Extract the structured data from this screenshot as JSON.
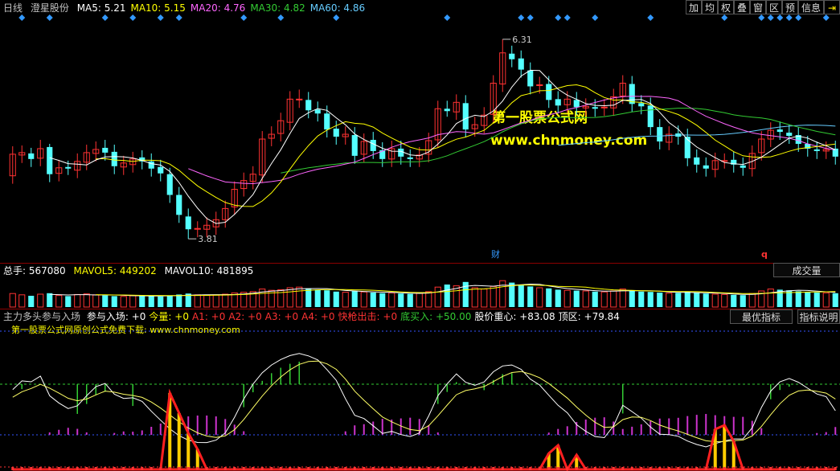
{
  "header": {
    "period": "日线",
    "stock": "澄星股份",
    "ma": [
      {
        "label": "MA5: 5.21",
        "color": "#ffffff"
      },
      {
        "label": "MA10: 5.15",
        "color": "#ffff00"
      },
      {
        "label": "MA20: 4.76",
        "color": "#ff66ff"
      },
      {
        "label": "MA30: 4.82",
        "color": "#33cc33"
      },
      {
        "label": "MA60: 4.86",
        "color": "#66ccff"
      }
    ]
  },
  "toolbar": [
    "加",
    "均",
    "权",
    "叠",
    "窗",
    "区",
    "预",
    "信息",
    "⇥"
  ],
  "annotations": {
    "high": "6.31",
    "low": "3.81",
    "cai": "财",
    "q": "q"
  },
  "volume": {
    "total_label": "总手: 567080",
    "mavol5_label": "MAVOL5: 449202",
    "mavol10_label": "MAVOL10: 481895",
    "button": "成交量"
  },
  "indicator": {
    "title": "主力多头参与入场",
    "items": [
      {
        "label": "参与入场: +0",
        "color": "#ffffff"
      },
      {
        "label": "今量: +0",
        "color": "#ffff00"
      },
      {
        "label": "A1: +0",
        "color": "#ff3333"
      },
      {
        "label": "A2: +0",
        "color": "#ff3333"
      },
      {
        "label": "A3: +0",
        "color": "#ff3333"
      },
      {
        "label": "A4: +0",
        "color": "#ff3333"
      },
      {
        "label": "快枪出击: +0",
        "color": "#ff3333"
      },
      {
        "label": "底买入: +50.00",
        "color": "#33cc33"
      },
      {
        "label": "股价重心: +83.08",
        "color": "#ffffff"
      },
      {
        "label": "顶区: +79.84",
        "color": "#ffffff"
      }
    ],
    "btn1": "最优指标",
    "btn2": "指标说明",
    "notice": "第一股票公式网原创公式免费下载: www.chnmoney.com"
  },
  "watermark": {
    "line1": "第一股票公式网",
    "line2": "www.chnmoney.com"
  },
  "colors": {
    "up": "#ff3232",
    "down": "#54ffff"
  },
  "chart_data": {
    "type": "candlestick",
    "count": 90,
    "open": [
      4.6,
      4.86,
      4.88,
      4.82,
      4.96,
      4.63,
      4.71,
      4.67,
      4.77,
      4.88,
      4.95,
      4.9,
      4.71,
      4.74,
      4.83,
      4.78,
      4.71,
      4.62,
      4.36,
      4.09,
      3.93,
      3.93,
      3.96,
      4.05,
      4.21,
      4.44,
      4.53,
      4.61,
      5.07,
      5.13,
      5.27,
      5.55,
      5.55,
      5.43,
      5.38,
      5.19,
      5.09,
      5.11,
      4.87,
      5.05,
      4.92,
      4.81,
      4.94,
      4.83,
      4.81,
      4.87,
      5.05,
      5.44,
      5.4,
      5.51,
      5.19,
      5.23,
      5.37,
      5.75,
      6.13,
      6.07,
      5.92,
      5.73,
      5.75,
      5.56,
      5.49,
      5.55,
      5.45,
      5.46,
      5.45,
      5.45,
      5.6,
      5.75,
      5.51,
      5.48,
      5.21,
      5.02,
      5.13,
      5.09,
      4.83,
      4.73,
      4.68,
      4.78,
      4.8,
      4.73,
      4.69,
      4.89,
      5.06,
      5.18,
      5.14,
      5.11,
      5.0,
      4.93,
      4.91,
      4.94
    ],
    "close": [
      4.87,
      4.89,
      4.81,
      4.94,
      4.62,
      4.7,
      4.69,
      4.78,
      4.89,
      4.93,
      4.89,
      4.72,
      4.76,
      4.81,
      4.78,
      4.69,
      4.63,
      4.36,
      4.11,
      3.93,
      3.94,
      3.98,
      4.05,
      4.19,
      4.43,
      4.54,
      4.62,
      5.06,
      5.12,
      5.29,
      5.56,
      5.56,
      5.42,
      5.38,
      5.18,
      5.09,
      5.12,
      4.85,
      5.03,
      4.91,
      4.81,
      4.94,
      4.84,
      4.81,
      4.86,
      5.04,
      5.44,
      5.41,
      5.52,
      5.18,
      5.24,
      5.36,
      5.76,
      6.14,
      6.06,
      5.93,
      5.72,
      5.74,
      5.55,
      5.48,
      5.56,
      5.46,
      5.47,
      5.44,
      5.46,
      5.59,
      5.76,
      5.5,
      5.47,
      5.21,
      5.03,
      5.12,
      5.09,
      4.82,
      4.74,
      4.69,
      4.79,
      4.79,
      4.74,
      4.7,
      4.88,
      5.06,
      5.17,
      5.15,
      5.1,
      5.0,
      4.94,
      4.91,
      4.93,
      4.84
    ],
    "high": [
      4.97,
      4.98,
      4.95,
      5.05,
      5.0,
      4.8,
      4.79,
      4.88,
      4.99,
      5.03,
      5.05,
      4.99,
      4.85,
      4.9,
      4.92,
      4.88,
      4.8,
      4.7,
      4.46,
      4.19,
      4.03,
      4.08,
      4.15,
      4.29,
      4.53,
      4.64,
      4.72,
      5.16,
      5.22,
      5.39,
      5.66,
      5.68,
      5.65,
      5.53,
      5.48,
      5.29,
      5.22,
      5.21,
      5.13,
      5.15,
      5.02,
      5.04,
      5.04,
      4.93,
      4.96,
      5.14,
      5.54,
      5.54,
      5.62,
      5.61,
      5.34,
      5.46,
      5.86,
      6.31,
      6.23,
      6.17,
      6.02,
      5.84,
      5.85,
      5.66,
      5.66,
      5.65,
      5.57,
      5.56,
      5.56,
      5.69,
      5.86,
      5.85,
      5.61,
      5.58,
      5.31,
      5.22,
      5.23,
      5.19,
      4.93,
      4.83,
      4.89,
      4.88,
      4.9,
      4.83,
      4.98,
      5.16,
      5.27,
      5.28,
      5.24,
      5.21,
      5.1,
      5.03,
      5.03,
      5.04
    ],
    "low": [
      4.5,
      4.76,
      4.71,
      4.72,
      4.52,
      4.53,
      4.61,
      4.57,
      4.67,
      4.78,
      4.79,
      4.62,
      4.61,
      4.64,
      4.68,
      4.59,
      4.53,
      4.26,
      4.01,
      3.81,
      3.83,
      3.83,
      3.86,
      3.95,
      4.11,
      4.34,
      4.43,
      4.51,
      4.97,
      5.03,
      5.17,
      5.45,
      5.32,
      5.28,
      5.08,
      4.99,
      4.99,
      4.75,
      4.77,
      4.81,
      4.71,
      4.71,
      4.74,
      4.71,
      4.71,
      4.77,
      4.95,
      5.34,
      5.3,
      5.08,
      5.09,
      5.13,
      5.27,
      5.65,
      5.96,
      5.83,
      5.62,
      5.63,
      5.45,
      5.38,
      5.39,
      5.36,
      5.35,
      5.34,
      5.35,
      5.35,
      5.5,
      5.4,
      5.37,
      5.11,
      4.93,
      4.92,
      4.99,
      4.72,
      4.64,
      4.59,
      4.58,
      4.69,
      4.64,
      4.6,
      4.59,
      4.79,
      4.96,
      5.05,
      5.0,
      4.9,
      4.84,
      4.81,
      4.81,
      4.74
    ],
    "volume": [
      420,
      380,
      350,
      400,
      430,
      360,
      340,
      390,
      410,
      380,
      360,
      340,
      330,
      350,
      370,
      340,
      330,
      360,
      390,
      420,
      380,
      360,
      370,
      400,
      440,
      460,
      480,
      560,
      520,
      540,
      600,
      620,
      580,
      540,
      520,
      480,
      460,
      500,
      470,
      450,
      430,
      440,
      420,
      410,
      430,
      480,
      620,
      700,
      660,
      780,
      600,
      560,
      640,
      820,
      760,
      700,
      640,
      600,
      580,
      540,
      520,
      510,
      500,
      480,
      470,
      500,
      560,
      520,
      480,
      470,
      450,
      430,
      440,
      480,
      440,
      420,
      400,
      390,
      380,
      370,
      420,
      500,
      560,
      540,
      520,
      490,
      470,
      450,
      440,
      430
    ],
    "ylim": [
      3.6,
      6.5
    ]
  }
}
